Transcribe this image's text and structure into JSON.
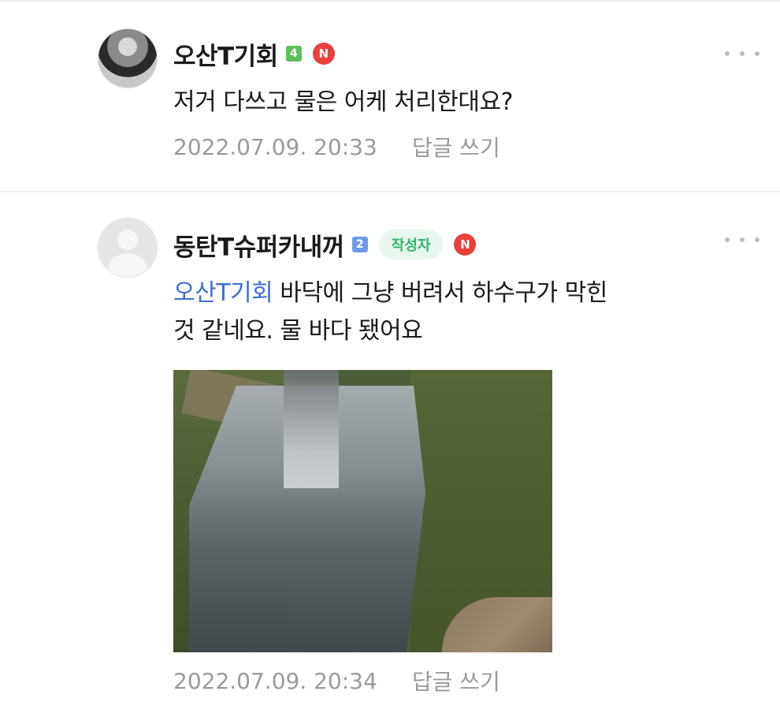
{
  "comments": [
    {
      "author": "오산T기회",
      "level": "4",
      "n_badge": "N",
      "text": "저거 다쓰고 물은 어케 처리한대요?",
      "timestamp": "2022.07.09. 20:33",
      "reply_label": "답글 쓰기",
      "avatar_icon": "profile-photo"
    },
    {
      "author": "동탄T슈퍼카내꺼",
      "level": "2",
      "writer_badge": "작성자",
      "n_badge": "N",
      "mention": "오산T기회",
      "text_line1": " 바닥에 그냥 버려서 하수구가 막힌",
      "text_line2": "것 같네요. 물 바다 됐어요",
      "timestamp": "2022.07.09. 20:34",
      "reply_label": "답글 쓰기",
      "avatar_icon": "default-profile-icon",
      "attachment": "flooded-ground-photo"
    }
  ],
  "colors": {
    "level_green": "#5cc25a",
    "level_blue": "#6f99e8",
    "writer_badge_bg": "#e7f7ee",
    "writer_badge_text": "#2fb36a",
    "n_badge": "#e8403a",
    "mention": "#3d6fd0",
    "meta_text": "#9a9a9a"
  }
}
